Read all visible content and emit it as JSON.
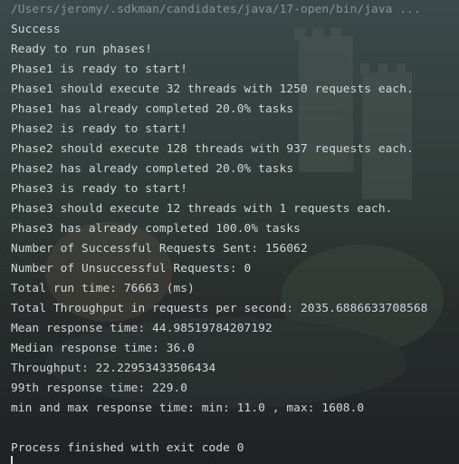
{
  "console": {
    "path_line": "/Users/jeromy/.sdkman/candidates/java/17-open/bin/java ...",
    "lines": [
      "Success",
      "Ready to run phases!",
      "Phase1 is ready to start!",
      "Phase1 should execute 32 threads with 1250 requests each.",
      "Phase1 has already completed 20.0% tasks",
      "Phase2 is ready to start!",
      "Phase2 should execute 128 threads with 937 requests each.",
      "Phase2 has already completed 20.0% tasks",
      "Phase3 is ready to start!",
      "Phase3 should execute 12 threads with 1 requests each.",
      "Phase3 has already completed 100.0% tasks",
      "Number of Successful Requests Sent: 156062",
      "Number of Unsuccessful Requests: 0",
      "Total run time: 76663 (ms)",
      "Total Throughput in requests per second: 2035.6886633708568",
      "Mean response time: 44.98519784207192",
      "Median response time: 36.0",
      "Throughput: 22.22953433506434",
      "99th response time: 229.0",
      "min and max response time: min: 11.0 , max: 1608.0",
      "",
      "Process finished with exit code 0"
    ]
  },
  "colors": {
    "text": "#d4d7dc",
    "path_text": "#8a9099",
    "background": "#1e2023"
  }
}
